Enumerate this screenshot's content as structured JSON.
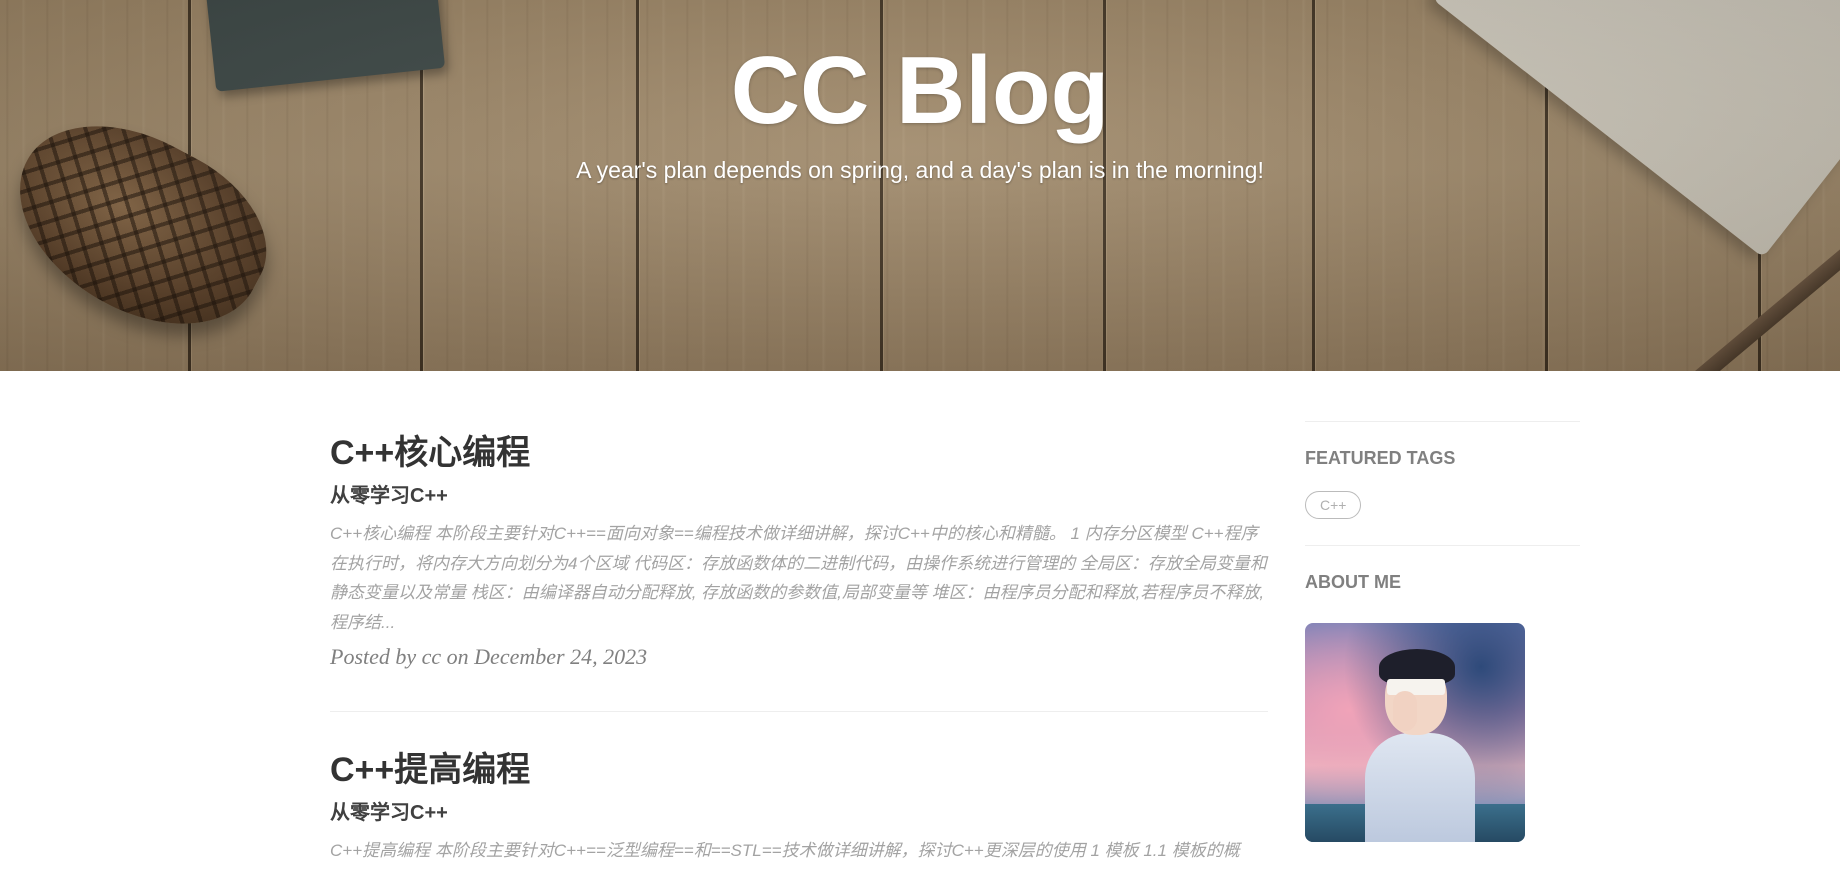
{
  "header": {
    "title": "CC Blog",
    "subtitle": "A year's plan depends on spring, and a day's plan is in the morning!"
  },
  "posts": [
    {
      "title": "C++核心编程",
      "subtitle": "从零学习C++",
      "excerpt": "C++核心编程 本阶段主要针对C++==面向对象==编程技术做详细讲解，探讨C++中的核心和精髓。 1 内存分区模型 C++程序在执行时，将内存大方向划分为4个区域 代码区：存放函数体的二进制代码，由操作系统进行管理的 全局区：存放全局变量和静态变量以及常量 栈区：由编译器自动分配释放, 存放函数的参数值,局部变量等 堆区：由程序员分配和释放,若程序员不释放,程序结...",
      "meta": "Posted by cc on December 24, 2023"
    },
    {
      "title": "C++提高编程",
      "subtitle": "从零学习C++",
      "excerpt": "C++提高编程 本阶段主要针对C++==泛型编程==和==STL==技术做详细讲解，探讨C++更深层的使用 1 模板 1.1 模板的概",
      "meta": ""
    }
  ],
  "sidebar": {
    "featured_tags_heading": "FEATURED TAGS",
    "tags": [
      "C++"
    ],
    "about_heading": "ABOUT ME"
  },
  "colors": {
    "title_text": "#333333",
    "excerpt_text": "#a3a3a3",
    "meta_text": "#808080",
    "sidebar_heading": "#808080"
  },
  "icons": {
    "avatar": "anime-avatar-image"
  }
}
